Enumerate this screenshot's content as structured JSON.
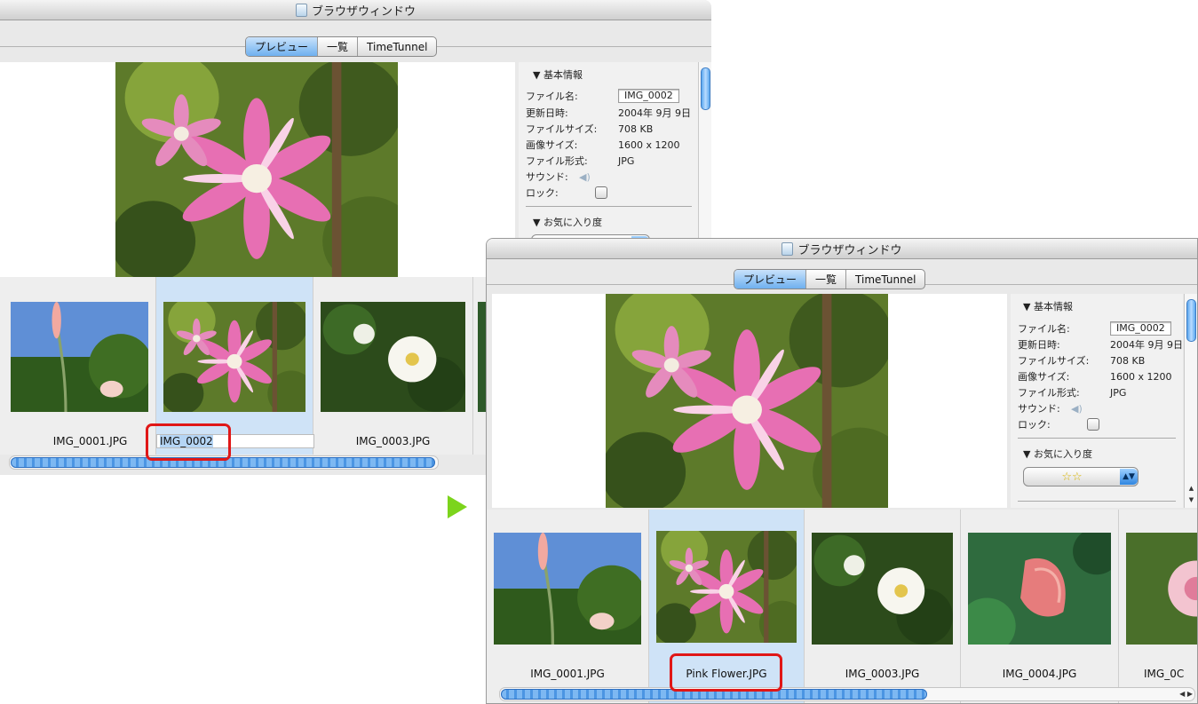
{
  "back_window": {
    "title": "ブラウザウィンドウ",
    "tabs": [
      "プレビュー",
      "一覧",
      "TimeTunnel"
    ],
    "info": {
      "section_basic": "▼ 基本情報",
      "file_name_label": "ファイル名:",
      "file_name_value": "IMG_0002",
      "modified_label": "更新日時:",
      "modified_value": "2004年 9月 9日",
      "file_size_label": "ファイルサイズ:",
      "file_size_value": "708 KB",
      "image_size_label": "画像サイズ:",
      "image_size_value": "1600 x 1200",
      "format_label": "ファイル形式:",
      "format_value": "JPG",
      "sound_label": "サウンド:",
      "lock_label": "ロック:",
      "section_fav": "▼ お気に入り度",
      "fav_value": "☆☆"
    },
    "thumbnails": [
      "IMG_0001.JPG",
      "IMG_0002",
      "IMG_0003.JPG"
    ],
    "edit_caption": "IMG_0002"
  },
  "front_window": {
    "title": "ブラウザウィンドウ",
    "tabs": [
      "プレビュー",
      "一覧",
      "TimeTunnel"
    ],
    "info": {
      "section_basic": "▼ 基本情報",
      "file_name_label": "ファイル名:",
      "file_name_value": "IMG_0002",
      "modified_label": "更新日時:",
      "modified_value": "2004年 9月 9日",
      "file_size_label": "ファイルサイズ:",
      "file_size_value": "708 KB",
      "image_size_label": "画像サイズ:",
      "image_size_value": "1600 x 1200",
      "format_label": "ファイル形式:",
      "format_value": "JPG",
      "sound_label": "サウンド:",
      "lock_label": "ロック:",
      "section_fav": "▼ お気に入り度",
      "fav_value": "☆☆"
    },
    "thumbnails": [
      "IMG_0001.JPG",
      "Pink Flower.JPG",
      "IMG_0003.JPG",
      "IMG_0004.JPG",
      "IMG_0C"
    ]
  },
  "colors": {
    "selection": "#cfe3f7",
    "highlight_box": "#e01717",
    "arrow": "#7cd41c",
    "accent": "#4b95e3"
  },
  "icons": {
    "title": "document-icon",
    "sound": "speaker-icon",
    "transition": "play-arrow-icon"
  }
}
